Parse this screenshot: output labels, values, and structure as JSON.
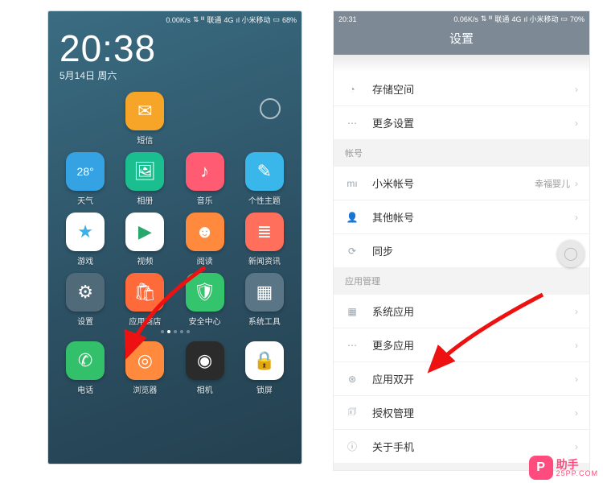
{
  "left": {
    "status": {
      "speed": "0.00K/s",
      "signal": "⇅ ᴵᴵᴵ",
      "carrier": "联通",
      "net": "4G",
      "sim2": "ıl 小米移动",
      "batt_icon": "▭",
      "batt": "68%"
    },
    "clock": {
      "time": "20:38",
      "date": "5月14日 周六"
    },
    "apps": [
      {
        "name": "短信",
        "icon": "✉",
        "bg": "#f7a529"
      },
      {
        "name": "天气",
        "icon": "28°",
        "bg": "#35a3e3",
        "small": true
      },
      {
        "name": "相册",
        "icon": "🖼",
        "bg": "#1bbe8e"
      },
      {
        "name": "音乐",
        "icon": "♪",
        "bg": "#ff5b73"
      },
      {
        "name": "个性主题",
        "icon": "✎",
        "bg": "#39b7ea"
      },
      {
        "name": "游戏",
        "icon": "★",
        "bg": "#ffffff",
        "fg": "#3bb1e7"
      },
      {
        "name": "视频",
        "icon": "▶",
        "bg": "#ffffff",
        "fg": "#2aa76b"
      },
      {
        "name": "阅读",
        "icon": "☻",
        "bg": "#ff8a3d"
      },
      {
        "name": "新闻资讯",
        "icon": "≣",
        "bg": "#ff6f5b"
      },
      {
        "name": "设置",
        "icon": "⚙",
        "bg": "#516a79"
      },
      {
        "name": "应用商店",
        "icon": "🛍",
        "bg": "#ff6a3a"
      },
      {
        "name": "安全中心",
        "icon": "🛡",
        "bg": "#35c46e"
      },
      {
        "name": "系统工具",
        "icon": "▦",
        "bg": "#5a7686"
      }
    ],
    "dock": [
      {
        "name": "电话",
        "icon": "✆",
        "bg": "#33c06a"
      },
      {
        "name": "浏览器",
        "icon": "◎",
        "bg": "#ff8a3d"
      },
      {
        "name": "相机",
        "icon": "◉",
        "bg": "#2b2b2b"
      },
      {
        "name": "锁屏",
        "icon": "🔒",
        "bg": "#ffffff",
        "fg": "#555"
      }
    ],
    "pager": {
      "count": 5,
      "active": 1
    }
  },
  "right": {
    "status": {
      "time": "20:31",
      "speed": "0.06K/s",
      "signal": "⇅ ᴵᴵᴵ",
      "carrier": "联通",
      "net": "4G",
      "sim2": "ıl 小米移动",
      "batt_icon": "▭",
      "batt": "70%"
    },
    "title": "设置",
    "items": [
      {
        "icon": "◔",
        "text": "存储空间"
      },
      {
        "icon": "⋯",
        "text": "更多设置"
      }
    ],
    "section_account": "帐号",
    "account": [
      {
        "icon": "mı",
        "text": "小米帐号",
        "sub": "幸福婴儿"
      },
      {
        "icon": "👤",
        "text": "其他帐号"
      },
      {
        "icon": "⟳",
        "text": "同步"
      }
    ],
    "section_apps": "应用管理",
    "appmgr": [
      {
        "icon": "▦",
        "text": "系统应用"
      },
      {
        "icon": "⋯",
        "text": "更多应用"
      },
      {
        "icon": "⊛",
        "text": "应用双开"
      },
      {
        "icon": "🗊",
        "text": "授权管理"
      },
      {
        "icon": "ⓘ",
        "text": "关于手机"
      }
    ]
  },
  "watermark": {
    "brand": "PP",
    "name1": "助手",
    "name2": "25PP.COM"
  }
}
